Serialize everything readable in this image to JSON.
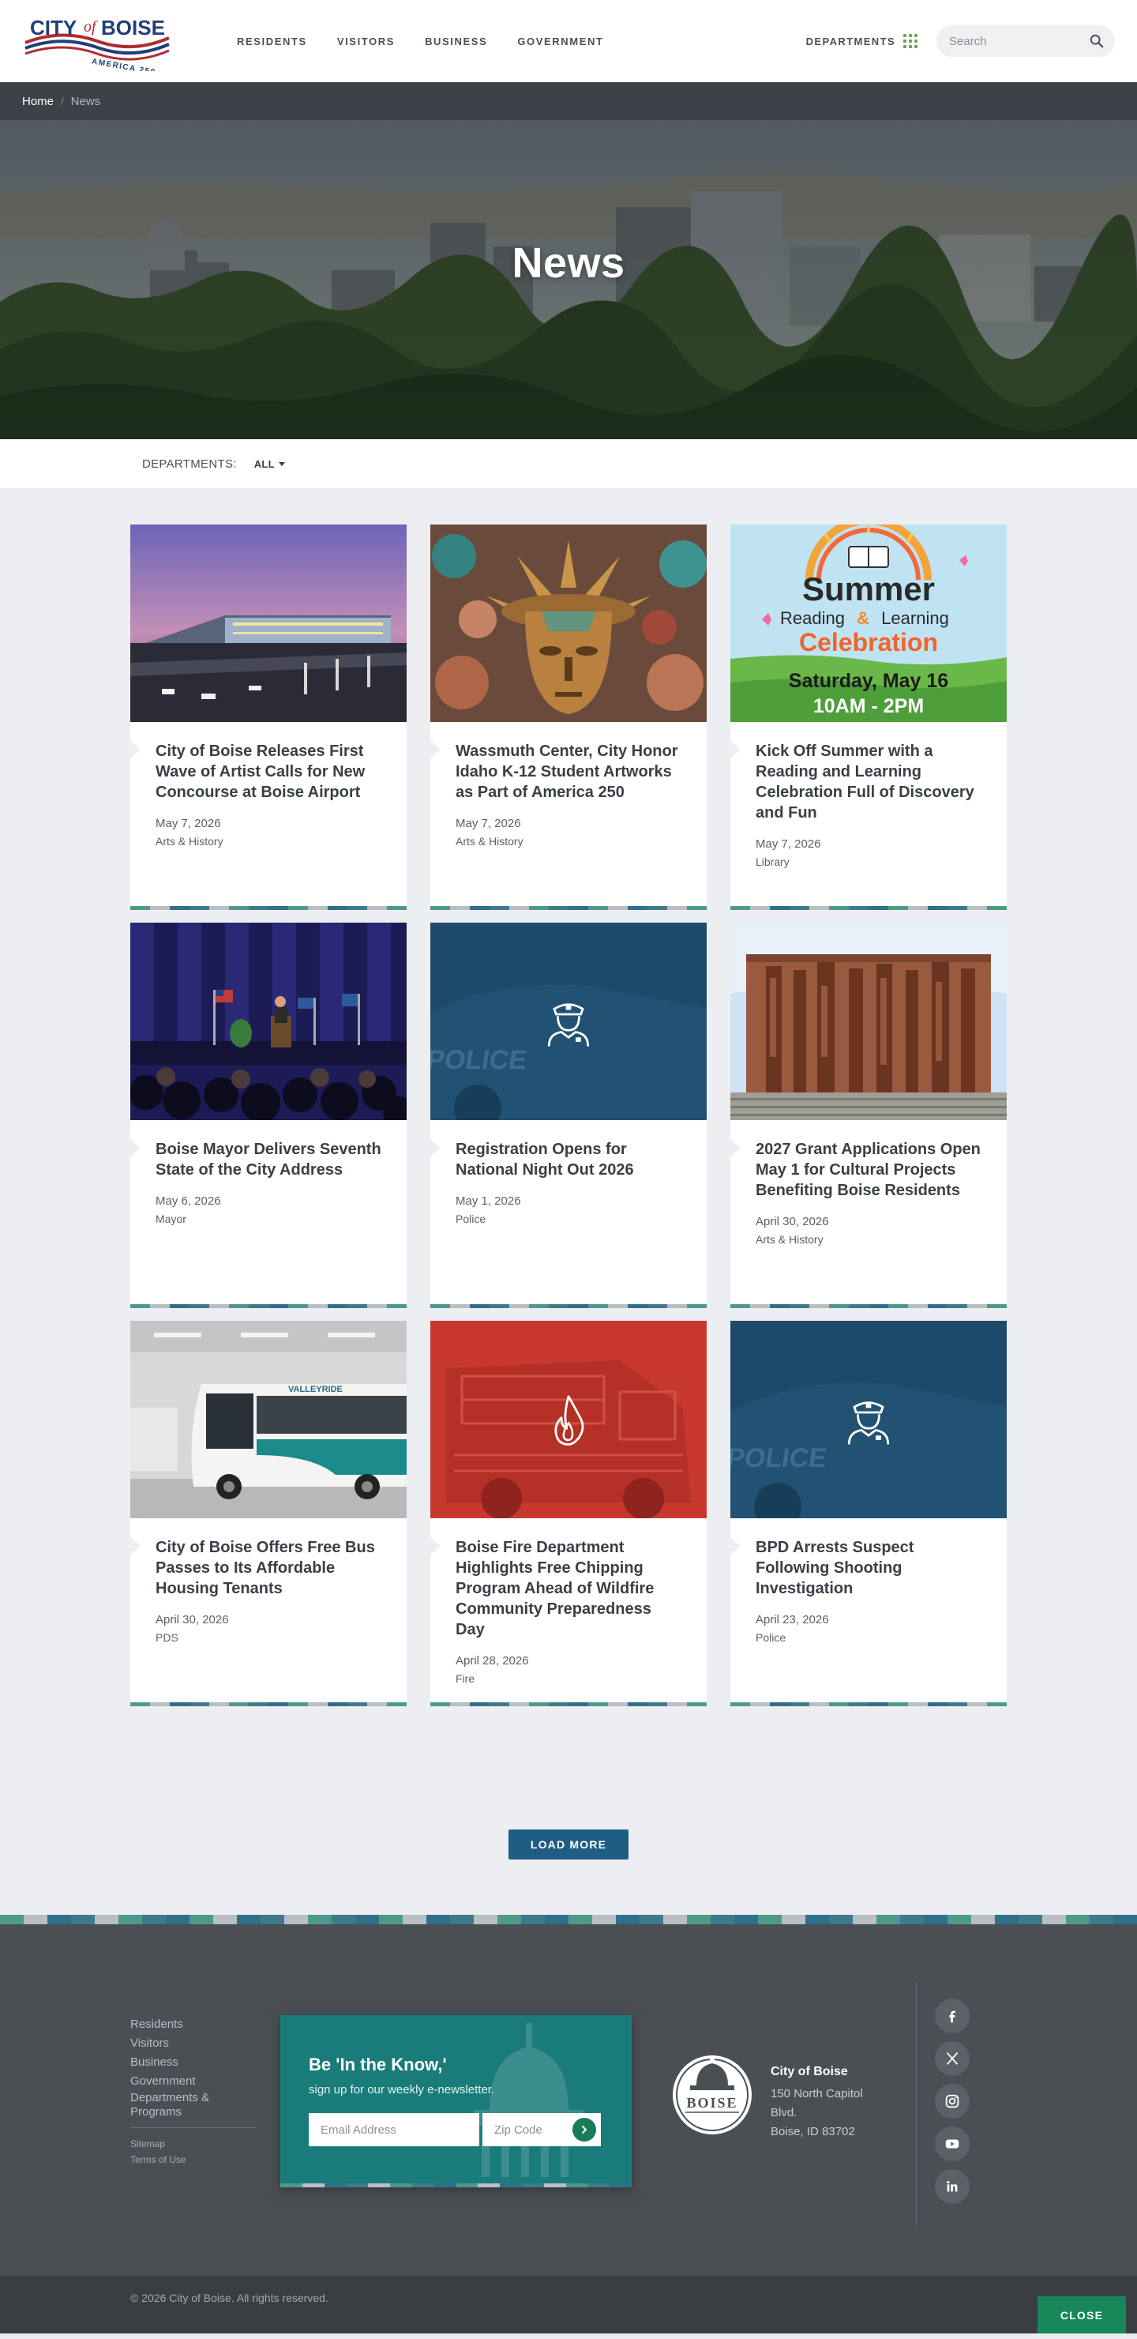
{
  "header": {
    "logo": {
      "line1": "CITY",
      "line2": "of",
      "line3": "BOISE",
      "line4": "AMERICA 250"
    },
    "nav": [
      "RESIDENTS",
      "VISITORS",
      "BUSINESS",
      "GOVERNMENT"
    ],
    "departments_label": "DEPARTMENTS",
    "search_placeholder": "Search"
  },
  "breadcrumb": {
    "home": "Home",
    "separator": "/",
    "current": "News"
  },
  "hero": {
    "title": "News"
  },
  "filter": {
    "label": "DEPARTMENTS:",
    "selected": "ALL"
  },
  "news": [
    {
      "title": "City of Boise Releases First Wave of Artist Calls for New Concourse at Boise Airport",
      "date": "May 7, 2026",
      "department": "Arts & History",
      "image": "airport-photo"
    },
    {
      "title": "Wassmuth Center, City Honor Idaho K-12 Student Artworks as Part of America 250",
      "date": "May 7, 2026",
      "department": "Arts & History",
      "image": "statue-of-liberty-collage"
    },
    {
      "title": "Kick Off Summer with a Reading and Learning Celebration Full of Discovery and Fun",
      "date": "May 7, 2026",
      "department": "Library",
      "image": "summer-celebration-poster",
      "poster": {
        "word1": "Summer",
        "word2": "Reading",
        "amp": "&",
        "word3": "Learning",
        "word4": "Celebration",
        "date": "Saturday, May 16",
        "time": "10AM - 2PM"
      }
    },
    {
      "title": "Boise Mayor Delivers Seventh State of the City Address",
      "date": "May 6, 2026",
      "department": "Mayor",
      "image": "mayor-speech-photo"
    },
    {
      "title": "Registration Opens for National Night Out 2026",
      "date": "May 1, 2026",
      "department": "Police",
      "image": "police-placeholder",
      "image_text": "POLICE"
    },
    {
      "title": "2027 Grant Applications Open May 1 for Cultural Projects Benefiting Boise Residents",
      "date": "April 30, 2026",
      "department": "Arts & History",
      "image": "building-sculpture-photo"
    },
    {
      "title": "City of Boise Offers Free Bus Passes to Its Affordable Housing Tenants",
      "date": "April 30, 2026",
      "department": "PDS",
      "image": "bus-photo",
      "image_text": "VALLEYRIDE"
    },
    {
      "title": "Boise Fire Department Highlights Free Chipping Program Ahead of Wildfire Community Preparedness Day",
      "date": "April 28, 2026",
      "department": "Fire",
      "image": "fire-placeholder"
    },
    {
      "title": "BPD Arrests Suspect Following Shooting Investigation",
      "date": "April 23, 2026",
      "department": "Police",
      "image": "police-placeholder",
      "image_text": "POLICE"
    }
  ],
  "load_more": "LOAD MORE",
  "footer": {
    "links": [
      "Residents",
      "Visitors",
      "Business",
      "Government",
      "Departments & Programs"
    ],
    "small_links": [
      "Sitemap",
      "Terms of Use"
    ],
    "newsletter": {
      "title": "Be 'In the Know,'",
      "subtitle": "sign up for our weekly e-newsletter.",
      "email_placeholder": "Email Address",
      "zip_placeholder": "Zip Code"
    },
    "seal_text": "BOISE",
    "address": {
      "name": "City of Boise",
      "line1": "150 North Capitol",
      "line2": "Blvd.",
      "line3": "Boise, ID 83702"
    },
    "social": [
      "facebook-icon",
      "x-icon",
      "instagram-icon",
      "youtube-icon",
      "linkedin-icon"
    ],
    "copyright": "© 2026 City of Boise. All rights reserved.",
    "close_label": "CLOSE"
  },
  "colors": {
    "brand_blue": "#1f5d84",
    "teal": "#1a7c7a",
    "green": "#17875a",
    "dark_gray": "#4a4f54",
    "stripe": [
      "#4e9a8a",
      "#7fb77e",
      "#3f7a8c",
      "#e0a63a",
      "#b9bec4",
      "#5aa06a",
      "#2f6f8a",
      "#9bc08a"
    ]
  }
}
